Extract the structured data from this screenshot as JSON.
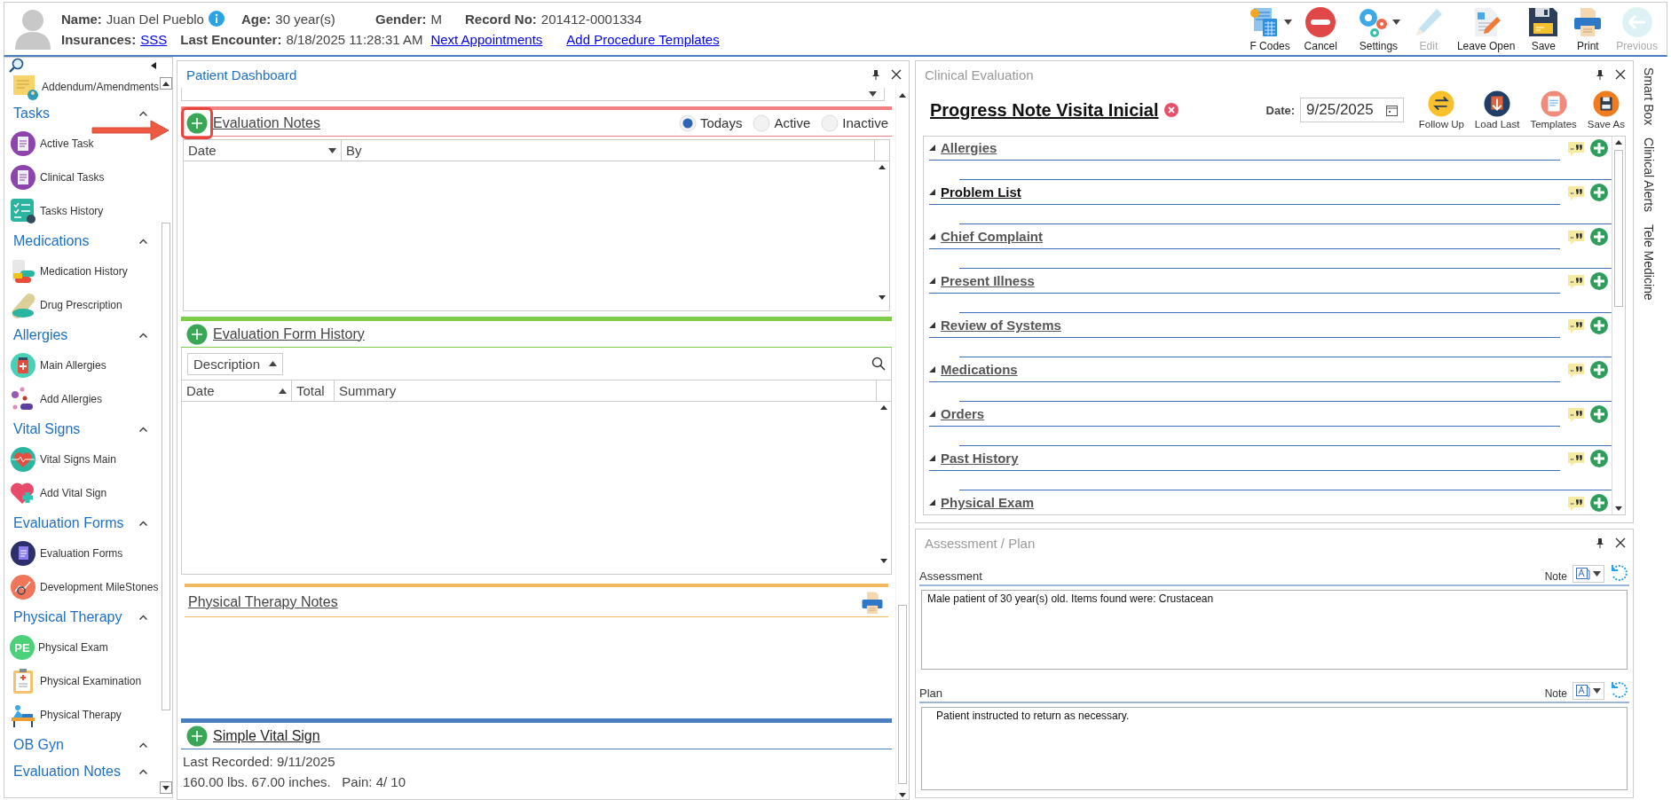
{
  "patient": {
    "fields": [
      {
        "label": "Name:",
        "value": "Juan Del Pueblo"
      },
      {
        "label": "Age:",
        "value": "30 year(s)"
      },
      {
        "label": "Gender:",
        "value": "M"
      },
      {
        "label": "Record No:",
        "value": "201412-0001334"
      }
    ],
    "details": [
      {
        "kind": "label",
        "text": "Insurances:"
      },
      {
        "kind": "link",
        "text": "SSS"
      },
      {
        "kind": "label",
        "text": "Last Encounter:"
      },
      {
        "kind": "value",
        "text": "8/18/2025 11:28:31 AM"
      },
      {
        "kind": "link",
        "text": "Next Appointments"
      },
      {
        "kind": "link",
        "text": "Add Procedure Templates"
      }
    ]
  },
  "toolbar": [
    {
      "label": "F Codes",
      "dropdown": true,
      "disabled": false
    },
    {
      "label": "Cancel",
      "dropdown": false,
      "disabled": false
    },
    {
      "label": "Settings",
      "dropdown": true,
      "disabled": false
    },
    {
      "label": "Edit",
      "dropdown": false,
      "disabled": true
    },
    {
      "label": "Leave Open",
      "dropdown": false,
      "disabled": false
    },
    {
      "label": "Save",
      "dropdown": false,
      "disabled": false
    },
    {
      "label": "Print",
      "dropdown": false,
      "disabled": false
    },
    {
      "label": "Previous",
      "dropdown": false,
      "disabled": true
    }
  ],
  "sidebar": {
    "top_item": "Addendum/Amendments",
    "groups": [
      {
        "title": "Tasks",
        "expanded": true,
        "items": [
          {
            "label": "Active Task"
          },
          {
            "label": "Clinical Tasks"
          },
          {
            "label": "Tasks History"
          }
        ]
      },
      {
        "title": "Medications",
        "expanded": true,
        "items": [
          {
            "label": "Medication History"
          },
          {
            "label": "Drug Prescription"
          }
        ]
      },
      {
        "title": "Allergies",
        "expanded": true,
        "items": [
          {
            "label": "Main Allergies"
          },
          {
            "label": "Add Allergies"
          }
        ]
      },
      {
        "title": "Vital Signs",
        "expanded": true,
        "items": [
          {
            "label": "Vital Signs Main"
          },
          {
            "label": "Add Vital Sign"
          }
        ]
      },
      {
        "title": "Evaluation Forms",
        "expanded": true,
        "items": [
          {
            "label": "Evaluation Forms"
          },
          {
            "label": "Development MileStones"
          }
        ]
      },
      {
        "title": "Physical Therapy",
        "expanded": true,
        "items": [
          {
            "label": "Physical Exam",
            "badge": "PE"
          },
          {
            "label": "Physical Examination"
          },
          {
            "label": "Physical Therapy"
          }
        ]
      },
      {
        "title": "OB Gyn",
        "expanded": true
      },
      {
        "title": "Evaluation Notes",
        "expanded": true
      }
    ]
  },
  "dashboard": {
    "title": "Patient Dashboard",
    "evaluation_notes": {
      "title": "Evaluation Notes",
      "highlighted": true,
      "filters": [
        {
          "label": "Todays",
          "selected": true
        },
        {
          "label": "Active",
          "selected": false
        },
        {
          "label": "Inactive",
          "selected": false
        }
      ],
      "columns": [
        "Date",
        "By"
      ]
    },
    "evaluation_form_history": {
      "title": "Evaluation Form History",
      "group_by": "Description",
      "columns": [
        "Date",
        "Total",
        "Summary"
      ]
    },
    "physical_therapy_notes": {
      "title": "Physical Therapy Notes"
    },
    "simple_vital_sign": {
      "title": "Simple Vital Sign",
      "lines": [
        "Last Recorded: 9/11/2025",
        "160.00 lbs. 67.00 inches.   Pain: 4/ 10"
      ]
    }
  },
  "clinical_evaluation": {
    "title": "Clinical Evaluation",
    "note_title": "Progress Note Visita Inicial",
    "date_label": "Date:",
    "date": "9/25/2025",
    "actions": [
      "Follow Up",
      "Load Last",
      "Templates",
      "Save As"
    ],
    "sections": [
      {
        "label": "Allergies",
        "selected": false,
        "expanded": true
      },
      {
        "label": "Problem List",
        "selected": true,
        "expanded": true
      },
      {
        "label": "Chief Complaint",
        "selected": false,
        "expanded": true
      },
      {
        "label": "Present Illness",
        "selected": false,
        "expanded": true
      },
      {
        "label": "Review of Systems",
        "selected": false,
        "expanded": true
      },
      {
        "label": "Medications",
        "selected": false,
        "expanded": true
      },
      {
        "label": "Orders",
        "selected": false,
        "expanded": true
      },
      {
        "label": "Past History",
        "selected": false,
        "expanded": true
      },
      {
        "label": "Physical Exam",
        "selected": false,
        "expanded": true
      }
    ]
  },
  "side_tabs": [
    "Smart Box",
    "Clinical Alerts",
    "Tele Medicine"
  ],
  "assessment_plan": {
    "title": "Assessment / Plan",
    "blocks": [
      {
        "label": "Assessment",
        "note_label": "Note",
        "text": "Male patient of 30 year(s) old. Items found were:  Crustacean"
      },
      {
        "label": "Plan",
        "note_label": "Note",
        "text": "Patient instructed to return as necessary."
      }
    ]
  }
}
